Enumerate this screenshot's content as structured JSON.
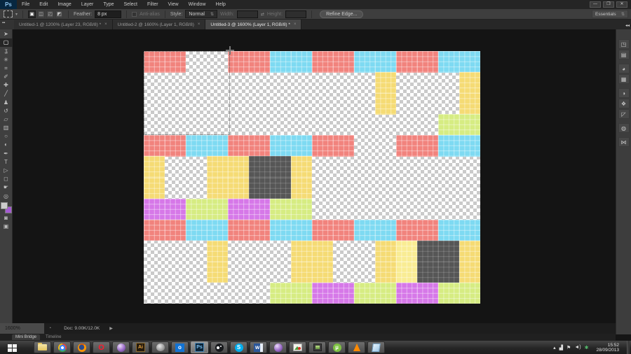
{
  "app": {
    "logo": "Ps",
    "menu": [
      "File",
      "Edit",
      "Image",
      "Layer",
      "Type",
      "Select",
      "Filter",
      "View",
      "Window",
      "Help"
    ],
    "window_buttons": {
      "minimize": "—",
      "restore": "❐",
      "close": "✕"
    }
  },
  "options_bar": {
    "tool_caret": "▾",
    "mode_buttons": [
      {
        "name": "new-selection",
        "glyph": "▣",
        "active": true
      },
      {
        "name": "add-to-selection",
        "glyph": "◫",
        "active": false
      },
      {
        "name": "subtract-from-selection",
        "glyph": "◰",
        "active": false
      },
      {
        "name": "intersect-selection",
        "glyph": "◩",
        "active": false
      }
    ],
    "feather_label": "Feather:",
    "feather_value": "8 px",
    "antialias_label": "Anti-alias",
    "style_label": "Style:",
    "style_value": "Normal",
    "style_caret": "⇅",
    "width_label": "Width:",
    "width_value": "",
    "swap_glyph": "⇄",
    "height_label": "Height:",
    "height_value": "",
    "refine_edge_label": "Refine Edge...",
    "workspace": "Essentials",
    "workspace_caret": "⇅"
  },
  "tab_bar": {
    "collapse_glyph": "▪▪",
    "dock_collapse_glyph": "◂◂",
    "close_glyph": "×",
    "tabs": [
      {
        "label": "Untitled-1 @ 1200% (Layer 23, RGB/8) *",
        "active": false
      },
      {
        "label": "Untitled-2 @ 1600% (Layer 1, RGB/8)",
        "active": false
      },
      {
        "label": "Untitled-3 @ 1600% (Layer 1, RGB/8) *",
        "active": true
      }
    ]
  },
  "tools": [
    {
      "name": "move-tool",
      "glyph": "➤",
      "active": false
    },
    {
      "name": "rectangular-marquee-tool",
      "glyph": "▢",
      "active": true
    },
    {
      "name": "lasso-tool",
      "glyph": "ʓ",
      "active": false
    },
    {
      "name": "quick-selection-tool",
      "glyph": "✳",
      "active": false
    },
    {
      "name": "crop-tool",
      "glyph": "⌗",
      "active": false
    },
    {
      "name": "eyedropper-tool",
      "glyph": "✐",
      "active": false
    },
    {
      "name": "healing-brush-tool",
      "glyph": "✚",
      "active": false
    },
    {
      "name": "brush-tool",
      "glyph": "╱",
      "active": false
    },
    {
      "name": "clone-stamp-tool",
      "glyph": "♟",
      "active": false
    },
    {
      "name": "history-brush-tool",
      "glyph": "↺",
      "active": false
    },
    {
      "name": "eraser-tool",
      "glyph": "▱",
      "active": false
    },
    {
      "name": "gradient-tool",
      "glyph": "▥",
      "active": false
    },
    {
      "name": "blur-tool",
      "glyph": "○",
      "active": false
    },
    {
      "name": "dodge-tool",
      "glyph": "◐",
      "active": false
    },
    {
      "name": "pen-tool",
      "glyph": "✒",
      "active": false
    },
    {
      "name": "type-tool",
      "glyph": "T",
      "active": false
    },
    {
      "name": "path-selection-tool",
      "glyph": "▷",
      "active": false
    },
    {
      "name": "shape-tool",
      "glyph": "◻",
      "active": false
    },
    {
      "name": "hand-tool",
      "glyph": "☛",
      "active": false
    },
    {
      "name": "zoom-tool",
      "glyph": "◎",
      "active": false
    }
  ],
  "tools_bottom": [
    {
      "name": "quick-mask-mode",
      "glyph": "◙",
      "active": false
    },
    {
      "name": "screen-mode",
      "glyph": "▣",
      "active": false
    }
  ],
  "color_swatches": {
    "foreground": "#cdcdcd",
    "background": "#a55ad2"
  },
  "dock_icons": [
    {
      "name": "mini-bridge-panel-icon",
      "glyph": "◳",
      "gap_after": false
    },
    {
      "name": "properties-panel-icon",
      "glyph": "▤",
      "gap_after": true
    },
    {
      "name": "color-panel-icon",
      "glyph": "◕",
      "gap_after": false
    },
    {
      "name": "swatches-panel-icon",
      "glyph": "▦",
      "gap_after": true
    },
    {
      "name": "adjustments-panel-icon",
      "glyph": "◑",
      "gap_after": false
    },
    {
      "name": "styles-panel-icon",
      "glyph": "❖",
      "gap_after": false
    },
    {
      "name": "actions-panel-icon",
      "glyph": "◸",
      "gap_after": true
    },
    {
      "name": "navigator-panel-icon",
      "glyph": "◍",
      "gap_after": true
    },
    {
      "name": "character-panel-icon",
      "glyph": "⋈",
      "gap_after": false
    }
  ],
  "canvas": {
    "palette": {
      "R": "#F1837D",
      "C": "#7EDAF2",
      "Y": "#F5DB74",
      "y": "#F9EC93",
      "G": "#D6EC82",
      "M": "#D678E8",
      "D": "#565656"
    },
    "rows": [
      "RR..RRCCRRCCRRCC",
      "...........Y...Y",
      "...........Y...Y",
      "..............GG",
      "RRCCRRCCRR..RRCC",
      "Y..YYDDY........",
      "Y..YYDDY........",
      "MMGGMMGG........",
      "RRCCRRCCRRCCRRCC",
      "...Y...YY..YyDDY",
      "...Y...YY..YyDDY",
      "......GGMMGGMMGG"
    ]
  },
  "status_bar": {
    "zoom_value": "1600%",
    "status_icon": "◔",
    "doc_size": "Doc: 9.00K/12.0K",
    "arrow": "▶"
  },
  "bottom_panels": [
    {
      "label": "Mini Bridge",
      "active": true
    },
    {
      "label": "Timeline",
      "active": false
    }
  ],
  "taskbar": {
    "items": [
      {
        "name": "explorer-icon",
        "cls": "i-folder",
        "txt": "",
        "active": false
      },
      {
        "name": "chrome-icon",
        "cls": "i-chrome",
        "txt": "",
        "active": false
      },
      {
        "name": "firefox-icon",
        "cls": "i-firefox",
        "txt": "",
        "active": false
      },
      {
        "name": "opera-icon",
        "cls": "i-opera",
        "txt": "O",
        "active": false
      },
      {
        "name": "media-orb-icon",
        "cls": "i-orb",
        "txt": "",
        "active": false
      },
      {
        "name": "illustrator-icon",
        "cls": "i-ai",
        "txt": "Ai",
        "active": false
      },
      {
        "name": "gimp-icon",
        "cls": "i-gimp",
        "txt": "",
        "active": false
      },
      {
        "name": "outlook-icon",
        "cls": "i-outlook",
        "txt": "o",
        "active": false
      },
      {
        "name": "photoshop-icon",
        "cls": "i-ps",
        "txt": "Ps",
        "active": true
      },
      {
        "name": "steam-icon",
        "cls": "i-steam",
        "txt": "",
        "active": false
      },
      {
        "name": "skype-icon",
        "cls": "i-skype",
        "txt": "S",
        "active": false
      },
      {
        "name": "word-icon",
        "cls": "i-word",
        "txt": "w",
        "active": false
      },
      {
        "name": "media-orb2-icon",
        "cls": "i-orb",
        "txt": "",
        "active": false
      },
      {
        "name": "photo-viewer-icon",
        "cls": "i-photo1",
        "txt": "",
        "active": false
      },
      {
        "name": "image-editor-icon",
        "cls": "i-photo2",
        "txt": "",
        "active": false
      },
      {
        "name": "utorrent-icon",
        "cls": "i-utorrent",
        "txt": "µ",
        "active": false
      },
      {
        "name": "vlc-icon",
        "cls": "i-vlc",
        "txt": "",
        "active": false
      },
      {
        "name": "notes-icon",
        "cls": "i-notes",
        "txt": "",
        "active": false
      }
    ],
    "tray": {
      "hidden_icons_glyph": "▴",
      "network_glyph": "▟",
      "flag_glyph": "⚑",
      "volume_glyph": "◄)",
      "antivirus_glyph": "✱",
      "time": "15:52",
      "date": "28/09/2013"
    }
  }
}
